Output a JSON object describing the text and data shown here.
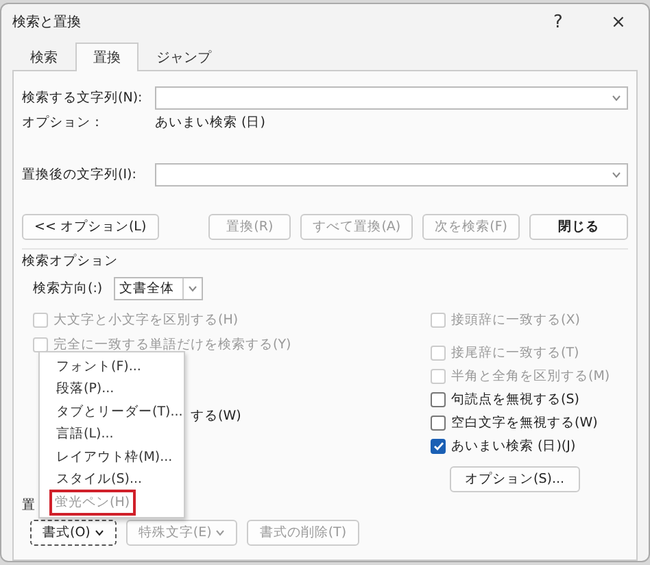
{
  "window": {
    "title": "検索と置換",
    "help": "?",
    "close": "×"
  },
  "tabs": [
    {
      "label": "検索",
      "selected": false
    },
    {
      "label": "置換",
      "selected": true
    },
    {
      "label": "ジャンプ",
      "selected": false
    }
  ],
  "find": {
    "label": "検索する文字列(N):"
  },
  "options_line": {
    "label": "オプション：",
    "value": "あいまい検索 (日)"
  },
  "replace": {
    "label": "置換後の文字列(I):"
  },
  "buttons": [
    {
      "label": "<< オプション(L)",
      "disabled": false,
      "bold": false
    },
    {
      "label": "置換(R)",
      "disabled": true,
      "bold": false
    },
    {
      "label": "すべて置換(A)",
      "disabled": true,
      "bold": false
    },
    {
      "label": "次を検索(F)",
      "disabled": true,
      "bold": false
    },
    {
      "label": "閉じる",
      "disabled": false,
      "bold": true
    }
  ],
  "search_options": {
    "title": "検索オプション",
    "direction_label": "検索方向(:)",
    "direction_value": "文書全体"
  },
  "left_checks": [
    {
      "label": "大文字と小文字を区別する(H)",
      "checked": false,
      "disabled": true,
      "kind": "checkbox"
    },
    {
      "label": "完全に一致する単語だけを検索する(Y)",
      "checked": false,
      "disabled": true,
      "kind": "checkbox"
    },
    {
      "kind": "spacer"
    },
    {
      "kind": "spacer"
    },
    {
      "label": "する(W)",
      "kind": "fragment"
    }
  ],
  "right_checks": [
    {
      "label": "接頭辞に一致する(X)",
      "checked": false,
      "disabled": true
    },
    {
      "label": "接尾辞に一致する(T)",
      "checked": false,
      "disabled": true
    },
    {
      "label": "半角と全角を区別する(M)",
      "checked": false,
      "disabled": true
    },
    {
      "label": "句読点を無視する(S)",
      "checked": false,
      "disabled": false
    },
    {
      "label": "空白文字を無視する(W)",
      "checked": false,
      "disabled": false
    },
    {
      "label": "あいまい検索 (日)(J)",
      "checked": true,
      "disabled": false
    }
  ],
  "options_button": "オプション(S)...",
  "replace_section": {
    "title": "置"
  },
  "bottom_buttons": [
    {
      "label": "書式(O)",
      "disabled": false,
      "focused": true,
      "caret": true
    },
    {
      "label": "特殊文字(E)",
      "disabled": true,
      "focused": false,
      "caret": true
    },
    {
      "label": "書式の削除(T)",
      "disabled": true,
      "focused": false,
      "caret": false
    }
  ],
  "format_menu": [
    {
      "label": "フォント(F)...",
      "highlighted": false,
      "disabled": false
    },
    {
      "label": "段落(P)...",
      "highlighted": false,
      "disabled": false
    },
    {
      "label": "タブとリーダー(T)...",
      "highlighted": false,
      "disabled": false
    },
    {
      "label": "言語(L)...",
      "highlighted": false,
      "disabled": false
    },
    {
      "label": "レイアウト枠(M)...",
      "highlighted": false,
      "disabled": false
    },
    {
      "label": "スタイル(S)...",
      "highlighted": false,
      "disabled": false
    },
    {
      "label": "蛍光ペン(H)",
      "highlighted": true,
      "disabled": true
    }
  ]
}
